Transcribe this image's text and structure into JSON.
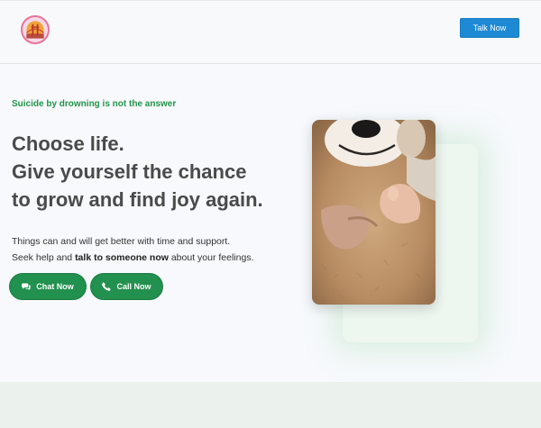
{
  "header": {
    "logo_icon": "golden-gate-bridge-logo",
    "talk_button_label": "Talk Now"
  },
  "hero": {
    "eyebrow": "Suicide by drowning is not the answer",
    "headline_strong": "Choose life.",
    "headline_line1": "Give yourself the chance",
    "headline_line2": "to grow and find joy again.",
    "body_line1": "Things can and will get better with time and support.",
    "body_line2_prefix": "Seek help and ",
    "body_line2_bold": "talk to someone now",
    "body_line2_suffix": " about your feelings.",
    "chat_button_label": "Chat Now",
    "chat_icon": "chat-bubbles-icon",
    "call_button_label": "Call Now",
    "call_icon": "phone-icon",
    "image": "teddy-bear-held-by-hands"
  },
  "colors": {
    "accent_blue": "#1e8ad6",
    "accent_green": "#22904e",
    "eyebrow_green": "#229448",
    "footer_band": "#ebf1ec"
  }
}
